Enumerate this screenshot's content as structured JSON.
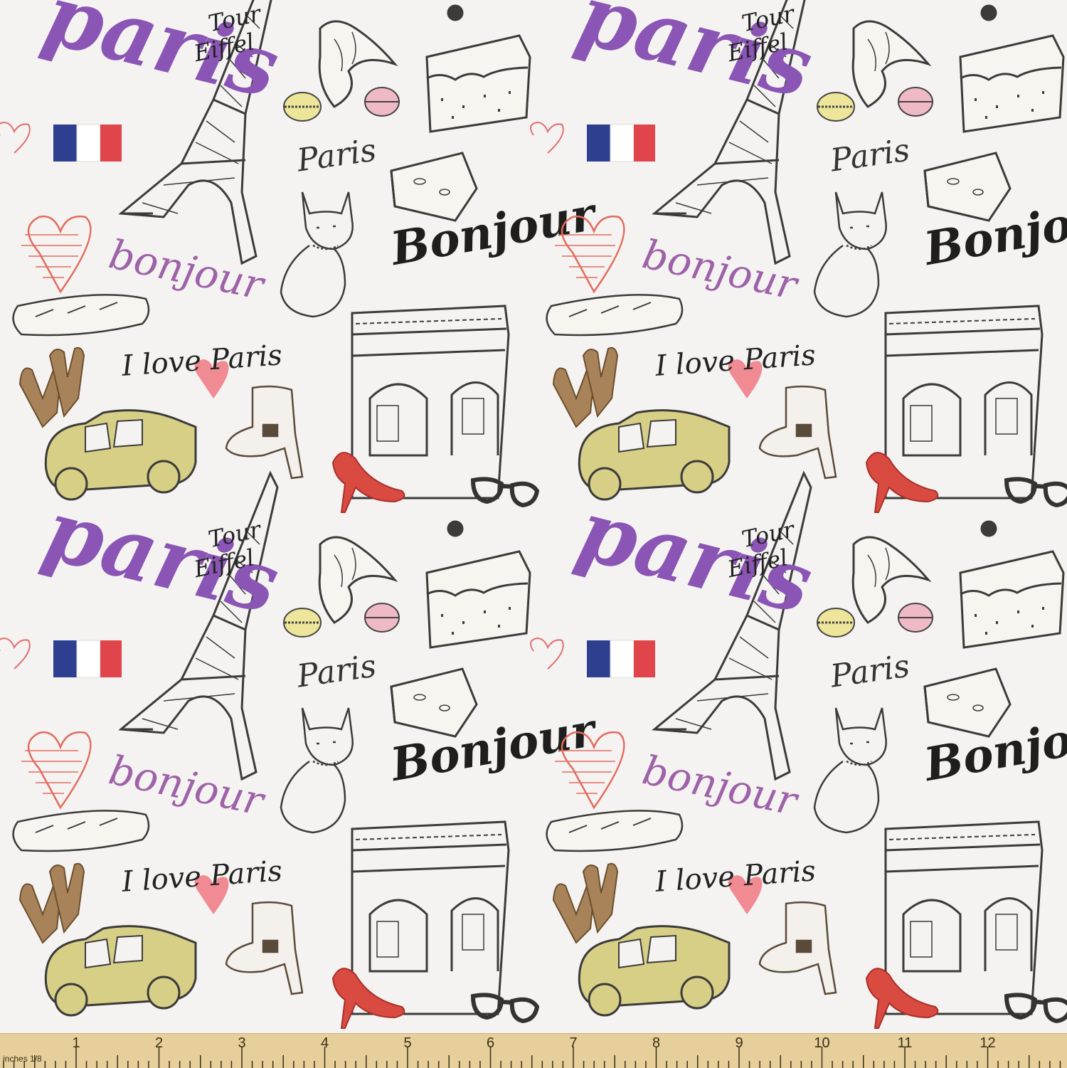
{
  "fabric": {
    "text": {
      "paris_large": "paris",
      "tour": "Tour",
      "eiffel": "Eiffel",
      "paris_script": "Paris",
      "bonjour_large": "Bonjour",
      "bonjour_small": "bonjour",
      "i_love_paris": "I love Paris"
    },
    "motifs": [
      "eiffel-tower-icon",
      "arc-de-triomphe-icon",
      "french-flag-icon",
      "croissant-icon",
      "macaron-icon",
      "cake-slice-icon",
      "cheese-icon",
      "cat-icon",
      "heart-icon",
      "baguette-icon",
      "gloves-icon",
      "retro-car-icon",
      "ankle-boot-icon",
      "red-high-heel-icon",
      "glasses-icon"
    ],
    "colors": {
      "background": "#f4f3f1",
      "purple": "#8a55b4",
      "flag_blue": "#2e3f8f",
      "flag_red": "#e0454b",
      "car": "#d8cf86",
      "heel": "#d94a40",
      "heart": "#e36b5d",
      "gloves": "#a8835a"
    }
  },
  "ruler": {
    "unit_label": "inches 1/8",
    "numbers": [
      "1",
      "2",
      "3",
      "4",
      "5",
      "6",
      "7",
      "8",
      "9",
      "10",
      "11",
      "12",
      "1"
    ]
  }
}
